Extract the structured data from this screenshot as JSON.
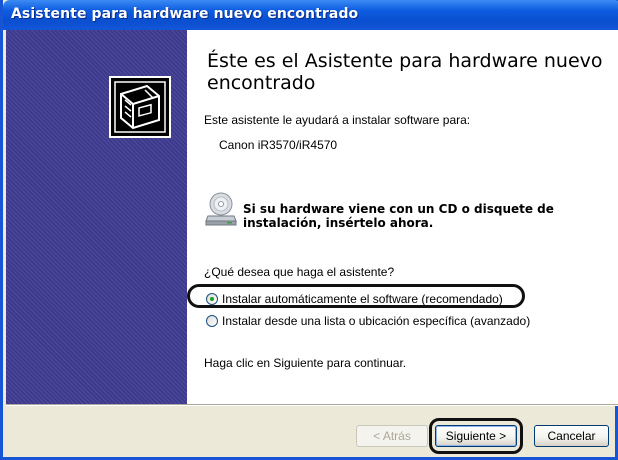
{
  "window": {
    "title": "Asistente para hardware nuevo encontrado",
    "accent": "#0a4fd0",
    "sidebar_color": "#3d3a8e"
  },
  "header": {
    "title": "Éste es el Asistente para hardware nuevo encontrado"
  },
  "body": {
    "intro": "Este asistente le ayudará a instalar software para:",
    "device_name": "Canon iR3570/iR4570",
    "cd_prompt": "Si su hardware viene con un CD o disquete de instalación, insértelo ahora.",
    "question": "¿Qué desea que haga el asistente?",
    "options": [
      {
        "label": "Instalar automáticamente el software (recomendado)",
        "checked": true
      },
      {
        "label": "Instalar desde una lista o ubicación específica (avanzado)",
        "checked": false
      }
    ],
    "continue_text": "Haga clic en Siguiente para continuar."
  },
  "footer": {
    "back_label": "< Atrás",
    "next_label": "Siguiente >",
    "cancel_label": "Cancelar"
  },
  "icons": {
    "sidebar": "hardware-card-icon",
    "cd": "cd-drive-icon"
  }
}
